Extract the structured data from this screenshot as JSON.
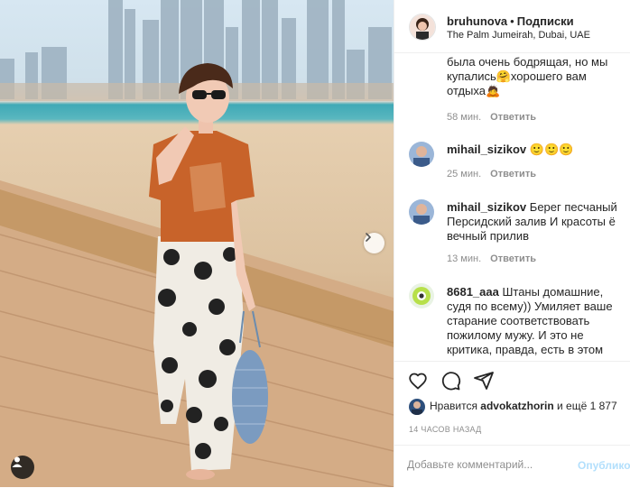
{
  "post": {
    "username": "bruhunova",
    "separator": "•",
    "follow_status": "Подписки",
    "location": "The Palm Jumeirah, Dubai, UAE"
  },
  "comments": [
    {
      "username": "",
      "text": "была очень бодрящая, но мы купались🤗хорошего вам отдыха🙇",
      "time": "58 мин.",
      "reply": "Ответить"
    },
    {
      "username": "mihail_sizikov",
      "text": "🙂🙂🙂",
      "time": "25 мин.",
      "reply": "Ответить"
    },
    {
      "username": "mihail_sizikov",
      "text": "Берег песчаный Персидский залив И красоты ё вечный прилив",
      "time": "13 мин.",
      "reply": "Ответить"
    },
    {
      "username": "8681_aaa",
      "text": "Штаны домашние, судя по всему)) Умиляет ваше старание соответствовать пожилому мужу. И это не критика, правда, есть в этом",
      "time": "",
      "reply": ""
    }
  ],
  "likes": {
    "prefix": "Нравится",
    "user": "advokatzhorin",
    "suffix": "и ещё 1 877"
  },
  "timestamp": "14 ЧАСОВ НАЗАД",
  "comment_box": {
    "placeholder": "Добавьте комментарий...",
    "publish_label": "Опубликовать"
  },
  "icons": {
    "like": "heart-icon",
    "comment": "comment-bubble-icon",
    "share": "paper-plane-icon",
    "next": "chevron-right-icon",
    "tags": "user-tag-icon"
  },
  "colors": {
    "text": "#262626",
    "muted": "#8e8e8e",
    "publish_disabled": "#b2dffc",
    "divider": "#efefef"
  }
}
